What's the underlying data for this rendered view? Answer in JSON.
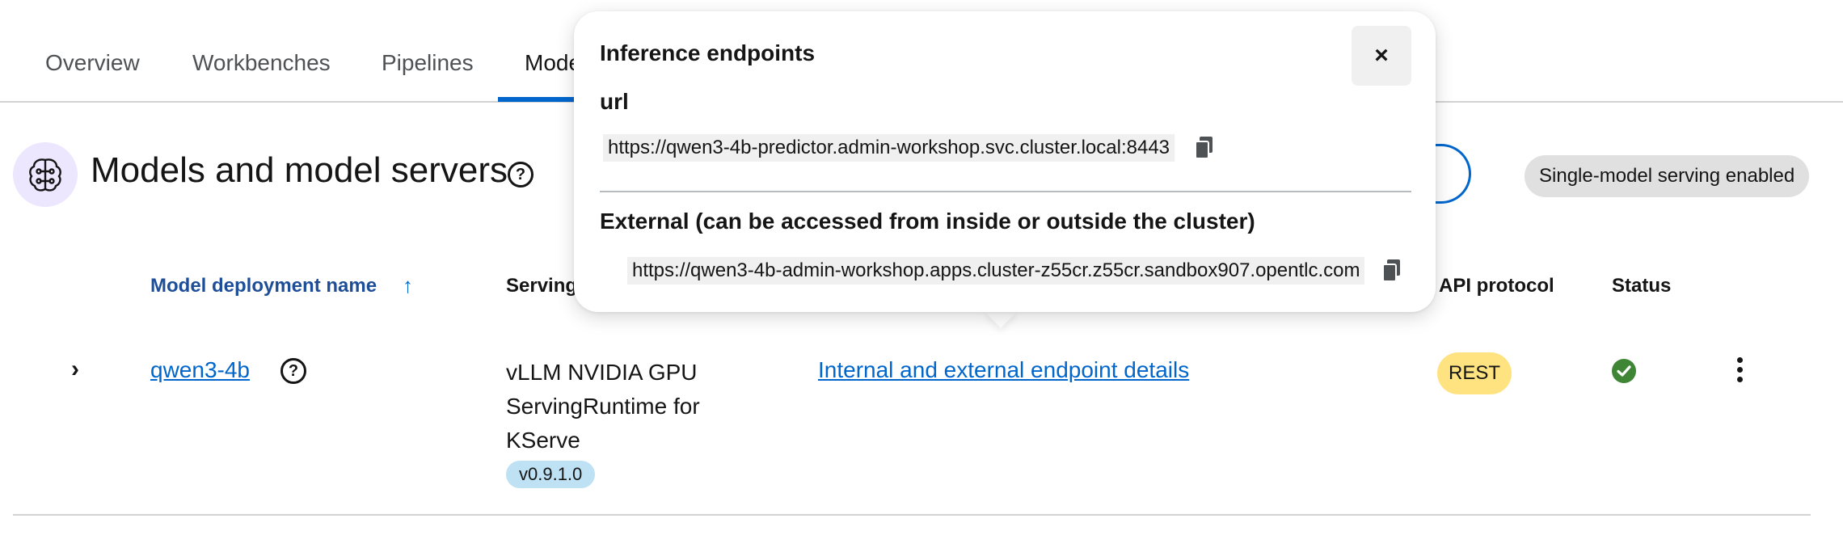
{
  "tabs": [
    {
      "label": "Overview"
    },
    {
      "label": "Workbenches"
    },
    {
      "label": "Pipelines"
    },
    {
      "label": "Mode"
    }
  ],
  "header": {
    "title": "Models and model servers",
    "serving_badge": "Single-model serving enabled"
  },
  "table": {
    "columns": {
      "name": "Model deployment name",
      "serving": "Serving",
      "api": "API protocol",
      "status": "Status"
    },
    "row": {
      "name": "qwen3-4b",
      "runtime": "vLLM NVIDIA GPU ServingRuntime for KServe",
      "version": "v0.9.1.0",
      "endpoint_link": "Internal and external endpoint details",
      "api": "REST"
    }
  },
  "popover": {
    "title": "Inference endpoints",
    "url_label": "url",
    "internal_url": "https://qwen3-4b-predictor.admin-workshop.svc.cluster.local:8443",
    "external_label": "External (can be accessed from inside or outside the cluster)",
    "external_url": "https://qwen3-4b-admin-workshop.apps.cluster-z55cr.z55cr.sandbox907.opentlc.com",
    "close_label": "×"
  },
  "colors": {
    "accent": "#0066cc",
    "status_ok": "#3e8635",
    "rest_badge": "#ffe380",
    "version_badge": "#bee1f4"
  }
}
